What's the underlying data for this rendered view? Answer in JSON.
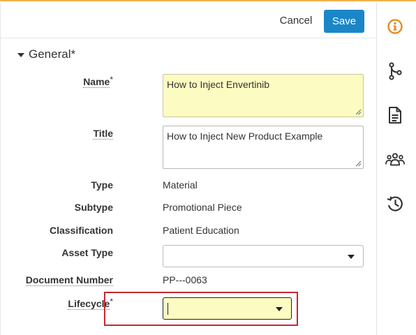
{
  "toolbar": {
    "cancel_label": "Cancel",
    "save_label": "Save"
  },
  "section": {
    "title": "General",
    "required_mark": "*"
  },
  "fields": {
    "name": {
      "label": "Name",
      "required_mark": "*",
      "value": "How to Inject Envertinib"
    },
    "title": {
      "label": "Title",
      "value": "How to Inject New Product Example"
    },
    "type": {
      "label": "Type",
      "value": "Material"
    },
    "subtype": {
      "label": "Subtype",
      "value": "Promotional Piece"
    },
    "classification": {
      "label": "Classification",
      "value": "Patient Education"
    },
    "asset_type": {
      "label": "Asset Type",
      "value": ""
    },
    "document_number": {
      "label": "Document Number",
      "value": "PP---0063"
    },
    "lifecycle": {
      "label": "Lifecycle",
      "required_mark": "*",
      "value": ""
    }
  },
  "rail": {
    "icons": [
      "info-icon",
      "branch-icon",
      "document-icon",
      "people-icon",
      "history-icon"
    ],
    "active": "info-icon"
  },
  "colors": {
    "accent": "#f0b24a",
    "save_button": "#1b86c7",
    "required_field_bg": "#fcfbc1",
    "highlight_border": "#c5282f",
    "active_icon": "#e8861a"
  }
}
